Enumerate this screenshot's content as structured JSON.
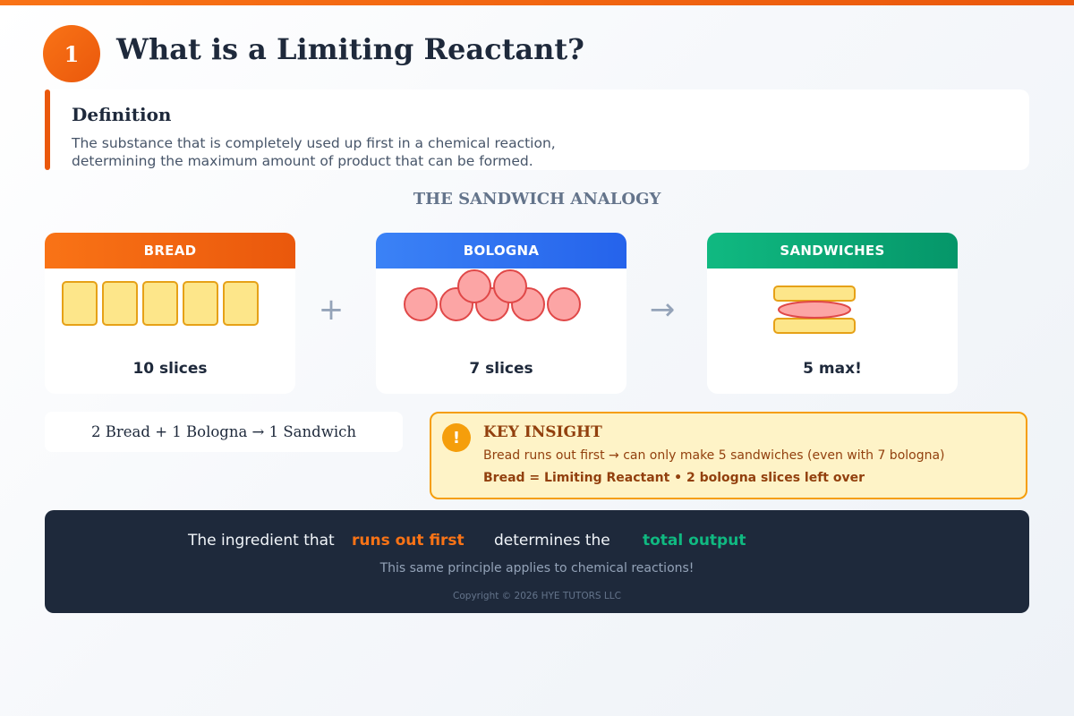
{
  "header": {
    "step_number": "1",
    "title": "What is a Limiting Reactant?"
  },
  "definition": {
    "title": "Definition",
    "line1": "The substance that is completely used up first in a chemical reaction,",
    "line2": "determining the maximum amount of product that can be formed."
  },
  "analogy": {
    "title": "THE SANDWICH ANALOGY",
    "plus": "+",
    "arrow": "→",
    "cards": [
      {
        "label": "BREAD",
        "count": "10 slices",
        "color": "#f97316"
      },
      {
        "label": "BOLOGNA",
        "count": "7 slices",
        "color": "#3b82f6"
      },
      {
        "label": "SANDWICHES",
        "count": "5 max!",
        "color": "#10b981"
      }
    ]
  },
  "equation": "2 Bread + 1 Bologna → 1 Sandwich",
  "insight": {
    "icon": "!",
    "title": "KEY INSIGHT",
    "line1": "Bread runs out first → can only make 5 sandwiches (even with 7 bologna)",
    "line2": "Bread = Limiting Reactant • 2 bologna slices left over"
  },
  "footer": {
    "part1": "The ingredient that",
    "highlight1": "runs out first",
    "part2": "determines the",
    "highlight2": "total output",
    "subtitle": "This same principle applies to chemical reactions!",
    "copyright": "Copyright © 2026 HYE TUTORS LLC"
  },
  "colors": {
    "accent_orange": "#f97316",
    "accent_green": "#10b981",
    "footer_bg": "#1e293b"
  }
}
